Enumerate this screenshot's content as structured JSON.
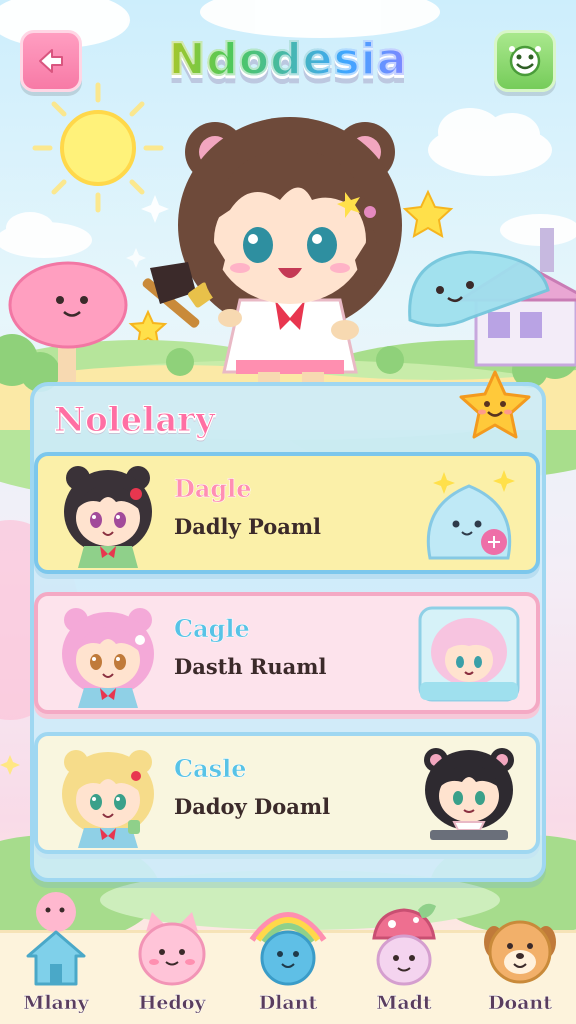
{
  "header": {
    "title": "Ndodesia",
    "back_icon": "arrow-left-icon",
    "menu_icon": "smiley-face-icon"
  },
  "panel": {
    "title": "Nolelary",
    "badge_icon": "smiling-star-icon"
  },
  "entries": [
    {
      "name": "Dagle",
      "subtitle": "Dadly Poaml",
      "avatar": "dark-hair-girl-avatar",
      "art": "blue-slime-creature-icon"
    },
    {
      "name": "Cagle",
      "subtitle": "Dasth Ruaml",
      "avatar": "pink-hair-girl-avatar",
      "art": "pink-hair-girl-card-icon"
    },
    {
      "name": "Casle",
      "subtitle": "Dadoy Doaml",
      "avatar": "blonde-hair-girl-avatar",
      "art": "black-hair-girl-laptop-icon"
    }
  ],
  "nav": [
    {
      "label": "Mlany",
      "icon": "house-icon"
    },
    {
      "label": "Hedoy",
      "icon": "pink-cat-icon"
    },
    {
      "label": "Dlant",
      "icon": "blue-blob-rainbow-icon"
    },
    {
      "label": "Madt",
      "icon": "mushroom-character-icon"
    },
    {
      "label": "Doant",
      "icon": "dog-face-icon"
    }
  ],
  "colors": {
    "accent_pink": "#ff6fa3",
    "accent_blue": "#58c3e6",
    "panel_bg": "#cdecfa",
    "entry_yellow": "#fbf0a9",
    "entry_pink": "#fde3ec"
  }
}
